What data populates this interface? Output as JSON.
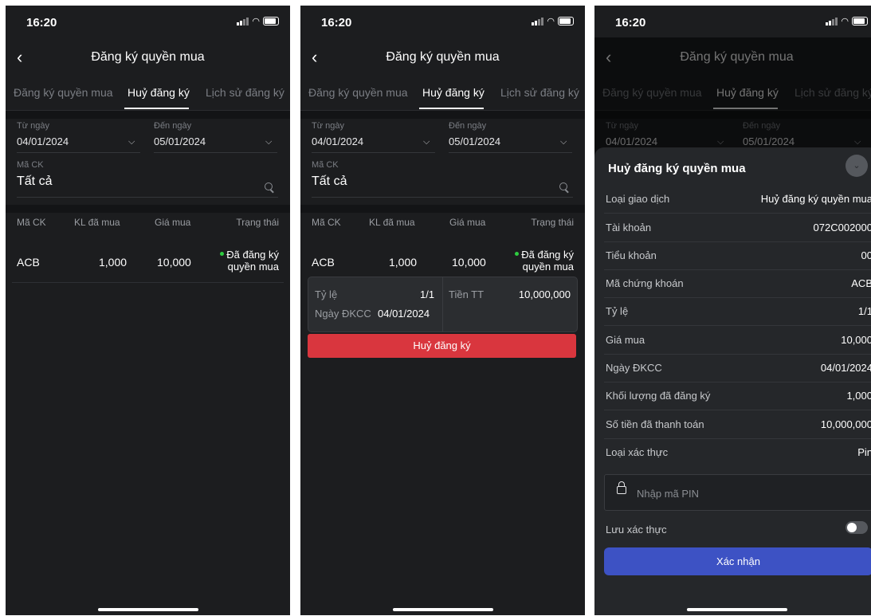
{
  "status_bar": {
    "time": "16:20"
  },
  "header": {
    "title": "Đăng ký quyền mua"
  },
  "tabs": [
    {
      "label": "Đăng ký quyền mua"
    },
    {
      "label": "Huỷ đăng ký"
    },
    {
      "label": "Lịch sử đăng ký"
    }
  ],
  "filters": {
    "from_label": "Từ ngày",
    "from_value": "04/01/2024",
    "to_label": "Đến ngày",
    "to_value": "05/01/2024",
    "symbol_label": "Mã CK",
    "symbol_value": "Tất cả"
  },
  "table": {
    "headers": [
      "Mã CK",
      "KL đã mua",
      "Giá mua",
      "Trạng thái"
    ],
    "row": {
      "symbol": "ACB",
      "quantity": "1,000",
      "price": "10,000",
      "status_line1": "Đã đăng ký",
      "status_line2": "quyền mua",
      "status_color": "#2ecc40"
    }
  },
  "detail": {
    "ratio_label": "Tỷ lệ",
    "ratio_value": "1/1",
    "payment_label": "Tiền TT",
    "payment_value": "10,000,000",
    "record_date_label": "Ngày ĐKCC",
    "record_date_value": "04/01/2024"
  },
  "cancel_button": {
    "label": "Huỷ đăng ký",
    "color": "#d9363e"
  },
  "sheet": {
    "title": "Huỷ đăng ký quyền mua",
    "rows": [
      {
        "label": "Loại giao dịch",
        "value": "Huỷ đăng ký quyền mua"
      },
      {
        "label": "Tài khoản",
        "value": "072C002000"
      },
      {
        "label": "Tiểu khoản",
        "value": "00"
      },
      {
        "label": "Mã chứng khoán",
        "value": "ACB"
      },
      {
        "label": "Tỷ lệ",
        "value": "1/1"
      },
      {
        "label": "Giá mua",
        "value": "10,000"
      },
      {
        "label": "Ngày ĐKCC",
        "value": "04/01/2024"
      },
      {
        "label": "Khối lượng đã đăng ký",
        "value": "1,000"
      },
      {
        "label": "Số tiền đã thanh toán",
        "value": "10,000,000"
      },
      {
        "label": "Loại xác thực",
        "value": "Pin"
      }
    ],
    "pin_placeholder": "Nhập mã PIN",
    "save_auth_label": "Lưu xác thực",
    "save_auth_on": false,
    "confirm_label": "Xác nhận",
    "confirm_color": "#3d52c4"
  }
}
